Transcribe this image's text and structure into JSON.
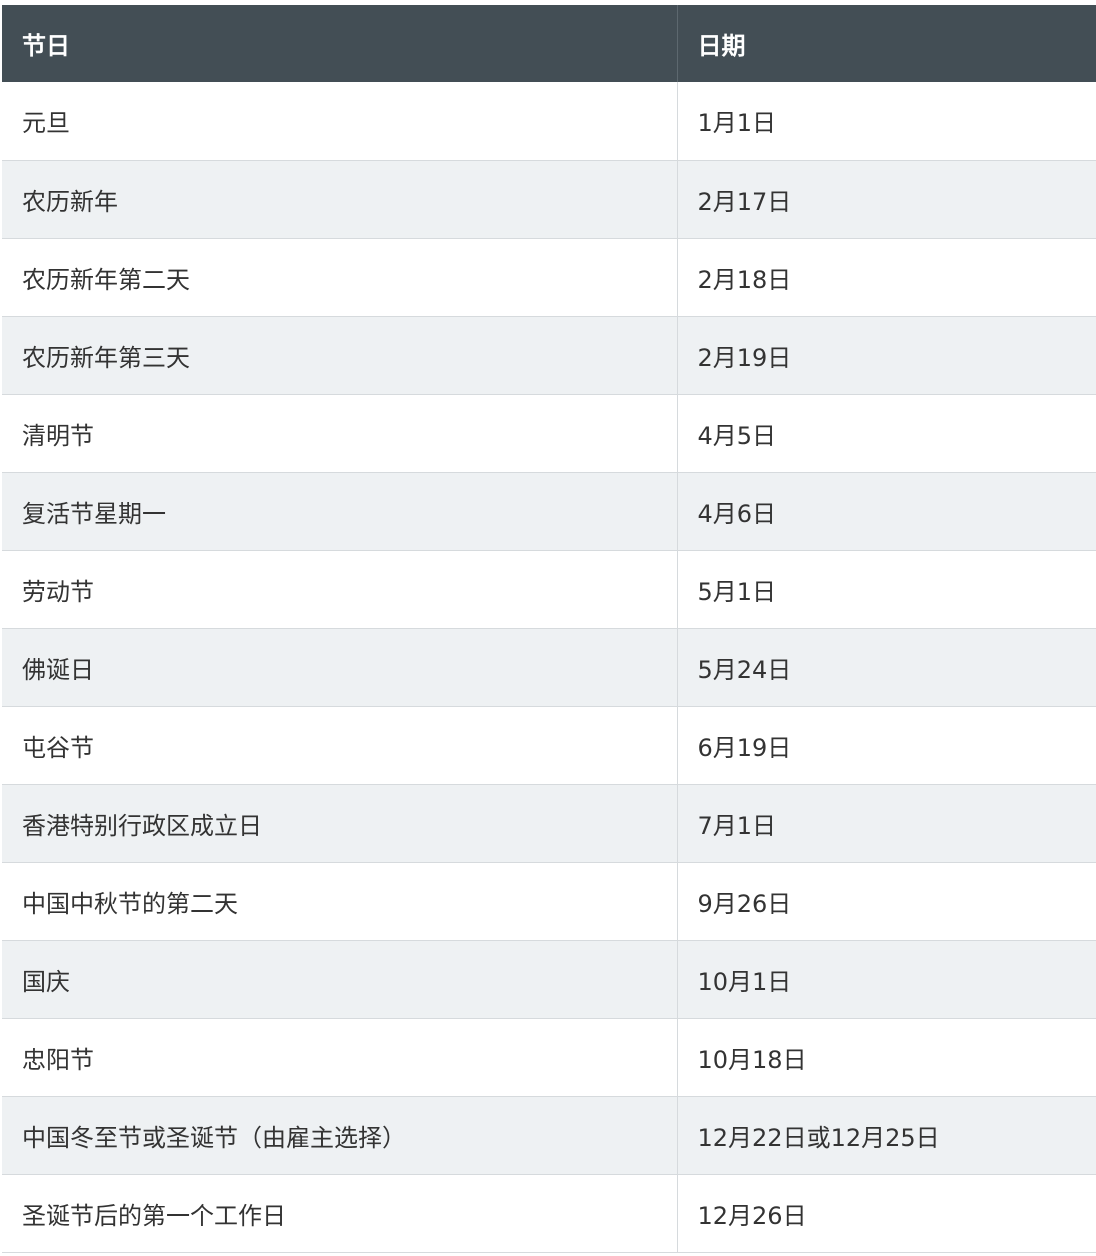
{
  "table": {
    "headers": [
      "节日",
      "日期"
    ],
    "rows": [
      {
        "holiday": "元旦",
        "date": "1月1日"
      },
      {
        "holiday": "农历新年",
        "date": "2月17日"
      },
      {
        "holiday": "农历新年第二天",
        "date": "2月18日"
      },
      {
        "holiday": "农历新年第三天",
        "date": "2月19日"
      },
      {
        "holiday": "清明节",
        "date": "4月5日"
      },
      {
        "holiday": "复活节星期一",
        "date": "4月6日"
      },
      {
        "holiday": "劳动节",
        "date": "5月1日"
      },
      {
        "holiday": "佛诞日",
        "date": "5月24日"
      },
      {
        "holiday": "屯谷节",
        "date": "6月19日"
      },
      {
        "holiday": "香港特别行政区成立日",
        "date": "7月1日"
      },
      {
        "holiday": "中国中秋节的第二天",
        "date": "9月26日"
      },
      {
        "holiday": "国庆",
        "date": "10月1日"
      },
      {
        "holiday": "忠阳节",
        "date": "10月18日"
      },
      {
        "holiday": "中国冬至节或圣诞节（由雇主选择）",
        "date": "12月22日或12月25日"
      },
      {
        "holiday": "圣诞节后的第一个工作日",
        "date": "12月26日"
      }
    ]
  },
  "colors": {
    "header_bg": "#434e55",
    "header_text": "#ffffff",
    "row_alt_bg": "#eef1f3",
    "border": "#d6dadd",
    "body_text": "#333333"
  }
}
